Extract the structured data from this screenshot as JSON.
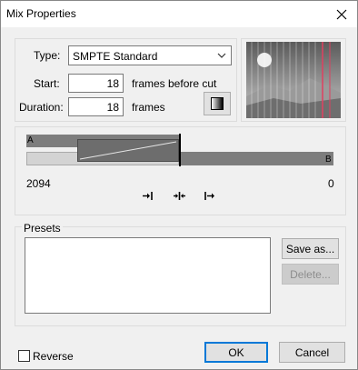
{
  "window": {
    "title": "Mix Properties"
  },
  "type": {
    "label": "Type:",
    "value": "SMPTE Standard"
  },
  "start": {
    "label": "Start:",
    "value": "18",
    "suffix": "frames before cut"
  },
  "duration": {
    "label": "Duration:",
    "value": "18",
    "suffix": "frames"
  },
  "timeline": {
    "track_a": "A",
    "track_b": "B",
    "left_value": "2094",
    "right_value": "0"
  },
  "presets": {
    "label": "Presets",
    "save_as": "Save as...",
    "delete": "Delete..."
  },
  "footer": {
    "reverse_label": "Reverse",
    "reverse_checked": false,
    "ok": "OK",
    "cancel": "Cancel"
  },
  "icons": {
    "close": "close-icon",
    "dropdown": "chevron-down-icon",
    "gradient": "gradient-icon",
    "align_left": "align-left-icon",
    "align_center": "align-center-icon",
    "align_right": "align-right-icon"
  }
}
